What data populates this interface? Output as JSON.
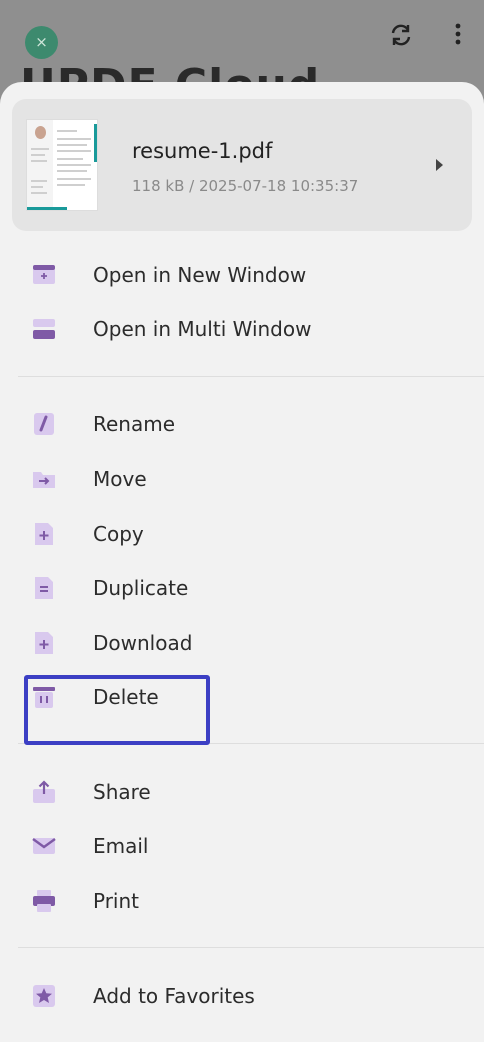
{
  "background": {
    "close_glyph": "×",
    "title_partial": "UPDF Cloud"
  },
  "file": {
    "name": "resume-1.pdf",
    "meta": "118 kB / 2025-07-18 10:35:37"
  },
  "menu": {
    "open_new_window": "Open in New Window",
    "open_multi_window": "Open in Multi Window",
    "rename": "Rename",
    "move": "Move",
    "copy": "Copy",
    "duplicate": "Duplicate",
    "download": "Download",
    "delete": "Delete",
    "share": "Share",
    "email": "Email",
    "print": "Print",
    "add_favorites": "Add to Favorites"
  },
  "colors": {
    "icon_light": "#d9c9ee",
    "icon_dark": "#7f5aa6",
    "highlight": "#3c3fc4"
  }
}
